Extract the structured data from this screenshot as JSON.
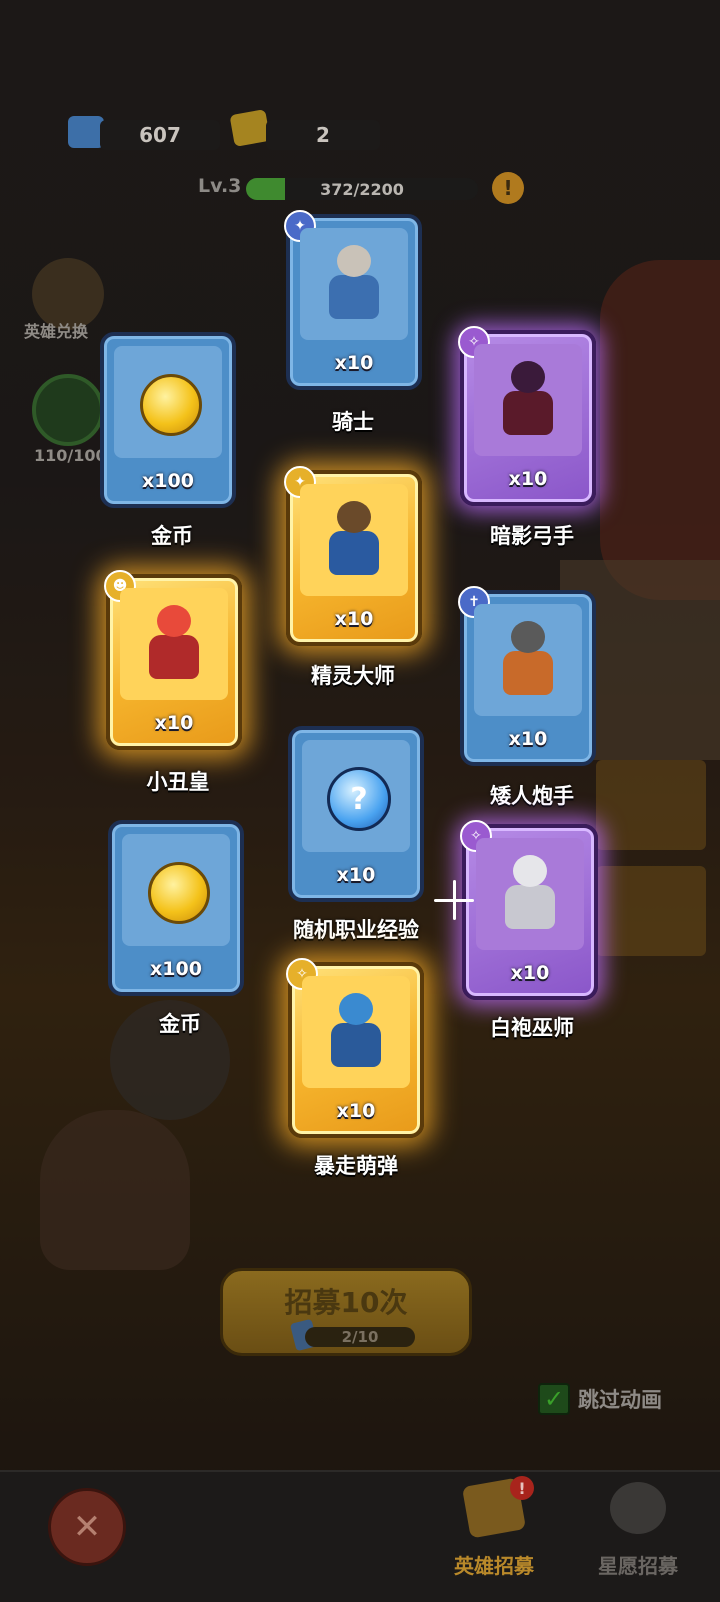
{
  "header": {
    "gems": "607",
    "tickets": "2",
    "level": "Lv.3",
    "xp": "372/2200",
    "xp_fraction": 0.169,
    "warn_icon": "!"
  },
  "side_buttons": {
    "hero_exchange": "英雄兑换",
    "progress": "110/100"
  },
  "cards": [
    {
      "name": "骑士",
      "qty": "x10",
      "rarity": "blue",
      "art": "knight"
    },
    {
      "name": "金币",
      "qty": "x100",
      "rarity": "blue",
      "art": "coin"
    },
    {
      "name": "暗影弓手",
      "qty": "x10",
      "rarity": "purple",
      "art": "archer"
    },
    {
      "name": "精灵大师",
      "qty": "x10",
      "rarity": "gold",
      "art": "elf"
    },
    {
      "name": "小丑皇",
      "qty": "x10",
      "rarity": "gold",
      "art": "clown"
    },
    {
      "name": "矮人炮手",
      "qty": "x10",
      "rarity": "blue",
      "art": "dwarf"
    },
    {
      "name": "随机职业经验",
      "qty": "x10",
      "rarity": "blue",
      "art": "orb"
    },
    {
      "name": "金币",
      "qty": "x100",
      "rarity": "blue",
      "art": "coin"
    },
    {
      "name": "白袍巫师",
      "qty": "x10",
      "rarity": "purple",
      "art": "wizard"
    },
    {
      "name": "暴走萌弹",
      "qty": "x10",
      "rarity": "gold",
      "art": "gunner"
    }
  ],
  "orb_symbol": "?",
  "recruit": {
    "label": "招募10次",
    "count": "2/10"
  },
  "skip": {
    "label": "跳过动画",
    "checked": true,
    "check_symbol": "✓"
  },
  "bottom_nav": {
    "close_symbol": "✕",
    "tabs": [
      {
        "label": "英雄招募",
        "active": true,
        "alert": "!"
      },
      {
        "label": "星愿招募",
        "active": false
      }
    ]
  },
  "colors": {
    "blue_card": "#4d8ec8",
    "gold_card": "#f5b32c",
    "purple_card": "#8a56c9",
    "active_tab": "#b9892a",
    "inactive_tab": "#6a6662"
  }
}
